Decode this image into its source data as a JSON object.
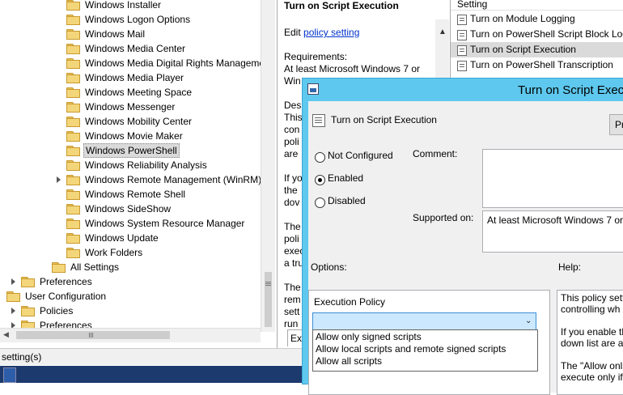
{
  "tree": {
    "items": [
      {
        "label": "Windows Installer",
        "indent": 2
      },
      {
        "label": "Windows Logon Options",
        "indent": 2
      },
      {
        "label": "Windows Mail",
        "indent": 2
      },
      {
        "label": "Windows Media Center",
        "indent": 2
      },
      {
        "label": "Windows Media Digital Rights Manageme",
        "indent": 2
      },
      {
        "label": "Windows Media Player",
        "indent": 2
      },
      {
        "label": "Windows Meeting Space",
        "indent": 2
      },
      {
        "label": "Windows Messenger",
        "indent": 2
      },
      {
        "label": "Windows Mobility Center",
        "indent": 2
      },
      {
        "label": "Windows Movie Maker",
        "indent": 2
      },
      {
        "label": "Windows PowerShell",
        "indent": 2,
        "selected": true
      },
      {
        "label": "Windows Reliability Analysis",
        "indent": 2
      },
      {
        "label": "Windows Remote Management (WinRM)",
        "indent": 2,
        "expandable": true
      },
      {
        "label": "Windows Remote Shell",
        "indent": 2
      },
      {
        "label": "Windows SideShow",
        "indent": 2
      },
      {
        "label": "Windows System Resource Manager",
        "indent": 2
      },
      {
        "label": "Windows Update",
        "indent": 2
      },
      {
        "label": "Work Folders",
        "indent": 2
      },
      {
        "label": "All Settings",
        "indent": 1
      },
      {
        "label": "Preferences",
        "indent": 0,
        "expandable": true
      },
      {
        "label": "User Configuration",
        "indent": -1
      },
      {
        "label": "Policies",
        "indent": 0,
        "expandable": true
      },
      {
        "label": "Preferences",
        "indent": 0,
        "expandable": true
      }
    ]
  },
  "description": {
    "title": "Turn on Script Execution",
    "edit_prefix": "Edit",
    "edit_link": "policy setting",
    "requirements_label": "Requirements:",
    "requirements_text": "At least Microsoft Windows 7 or",
    "lines": [
      "Win",
      "Des",
      "This",
      "con",
      "poli",
      "are",
      "If yo",
      "the",
      "dov",
      "The",
      "poli",
      "exec",
      "a tru",
      "The",
      "rem",
      "sett",
      "run"
    ],
    "tab_label": "Ext"
  },
  "settings": {
    "header": "Setting",
    "items": [
      "Turn on Module Logging",
      "Turn on PowerShell Script Block Log",
      "Turn on Script Execution",
      "Turn on PowerShell Transcription"
    ]
  },
  "statusbar": {
    "text": "setting(s)"
  },
  "dialog": {
    "title": "Turn on Script Execu",
    "heading": "Turn on Script Execution",
    "prev_button": "Pr",
    "radios": [
      {
        "label": "Not Configured",
        "checked": false
      },
      {
        "label": "Enabled",
        "checked": true
      },
      {
        "label": "Disabled",
        "checked": false
      }
    ],
    "comment_label": "Comment:",
    "supported_label": "Supported on:",
    "supported_value": "At least Microsoft Windows 7 or",
    "options_label": "Options:",
    "help_label": "Help:",
    "execution_policy_label": "Execution Policy",
    "dropdown_value": "",
    "dropdown_options": [
      "Allow only signed scripts",
      "Allow local scripts and remote signed scripts",
      "Allow all scripts"
    ],
    "help_lines": [
      "This policy sett",
      "controlling wh",
      "",
      "If you enable th",
      "down list are al",
      "",
      "The \"Allow onl",
      "execute only if"
    ]
  },
  "colors": {
    "dialog_frame": "#5ec8ee",
    "link": "#0033cc",
    "selection": "#cce8ff"
  }
}
